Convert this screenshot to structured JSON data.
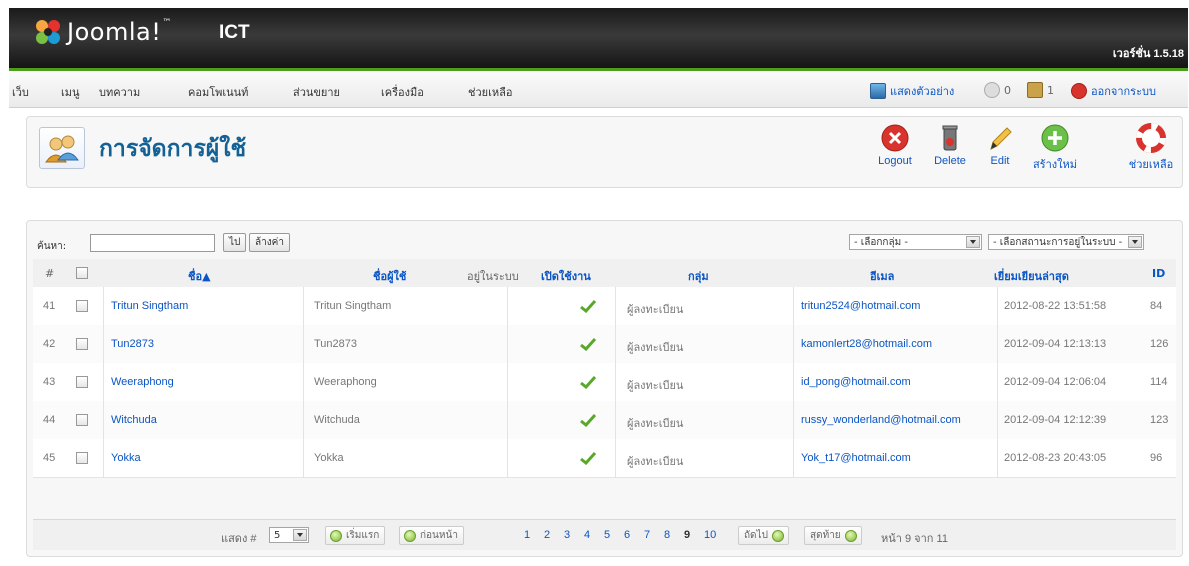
{
  "header": {
    "logo_text": "Joomla!",
    "logo_tm": "™",
    "site_name": "ICT",
    "version": "เวอร์ชั่น 1.5.18"
  },
  "menu": {
    "items": [
      "เว็บ",
      "เมนู",
      "บทความ",
      "คอมโพเนนท์",
      "ส่วนขยาย",
      "เครื่องมือ",
      "ช่วยเหลือ"
    ],
    "preview": "แสดงตัวอย่าง",
    "messages_count": "0",
    "users_count": "1",
    "logout": "ออกจากระบบ"
  },
  "toolbar": {
    "title": "การจัดการผู้ใช้",
    "buttons": [
      {
        "label": "Logout",
        "icon": "logout-icon"
      },
      {
        "label": "Delete",
        "icon": "trash-icon"
      },
      {
        "label": "Edit",
        "icon": "pencil-icon"
      },
      {
        "label": "สร้างใหม่",
        "icon": "plus-icon"
      },
      {
        "label": "ช่วยเหลือ",
        "icon": "lifebuoy-icon"
      }
    ]
  },
  "filter": {
    "label": "ค้นหา:",
    "search_value": "",
    "go_label": "ไป",
    "reset_label": "ล้างค่า",
    "group_select": "- เลือกกลุ่ม -",
    "status_select": "- เลือกสถานะการอยู่ในระบบ -"
  },
  "table": {
    "headers": {
      "num": "#",
      "name": "ชื่อ▲",
      "username": "ชื่อผู้ใช้",
      "logged_in": "อยู่ในระบบ",
      "enabled": "เปิดใช้งาน",
      "group": "กลุ่ม",
      "email": "อีเมล",
      "last_visit": "เยี่ยมเยียนล่าสุด",
      "id": "ID"
    },
    "rows": [
      {
        "num": "41",
        "name": "Tritun Singtham",
        "username": "Tritun Singtham",
        "group": "ผู้ลงทะเบียน",
        "email": "tritun2524@hotmail.com",
        "last_visit": "2012-08-22 13:51:58",
        "id": "84"
      },
      {
        "num": "42",
        "name": "Tun2873",
        "username": "Tun2873",
        "group": "ผู้ลงทะเบียน",
        "email": "kamonlert28@hotmail.com",
        "last_visit": "2012-09-04 12:13:13",
        "id": "126"
      },
      {
        "num": "43",
        "name": "Weeraphong",
        "username": "Weeraphong",
        "group": "ผู้ลงทะเบียน",
        "email": "id_pong@hotmail.com",
        "last_visit": "2012-09-04 12:06:04",
        "id": "114"
      },
      {
        "num": "44",
        "name": "Witchuda",
        "username": "Witchuda",
        "group": "ผู้ลงทะเบียน",
        "email": "russy_wonderland@hotmail.com",
        "last_visit": "2012-09-04 12:12:39",
        "id": "123"
      },
      {
        "num": "45",
        "name": "Yokka",
        "username": "Yokka",
        "group": "ผู้ลงทะเบียน",
        "email": "Yok_t17@hotmail.com",
        "last_visit": "2012-08-23 20:43:05",
        "id": "96"
      }
    ]
  },
  "pagination": {
    "display_label": "แสดง #",
    "display_value": "5",
    "first": "เริ่มแรก",
    "prev": "ก่อนหน้า",
    "pages": [
      "1",
      "2",
      "3",
      "4",
      "5",
      "6",
      "7",
      "8",
      "9",
      "10"
    ],
    "current_page": "9",
    "next": "ถัดไป",
    "last": "สุดท้าย",
    "page_info": "หน้า 9 จาก 11"
  },
  "colors": {
    "header_bg": "#1f1f1f",
    "accent_green": "#4c9e1c",
    "link_blue": "#0b55c4",
    "title_blue": "#146295"
  }
}
